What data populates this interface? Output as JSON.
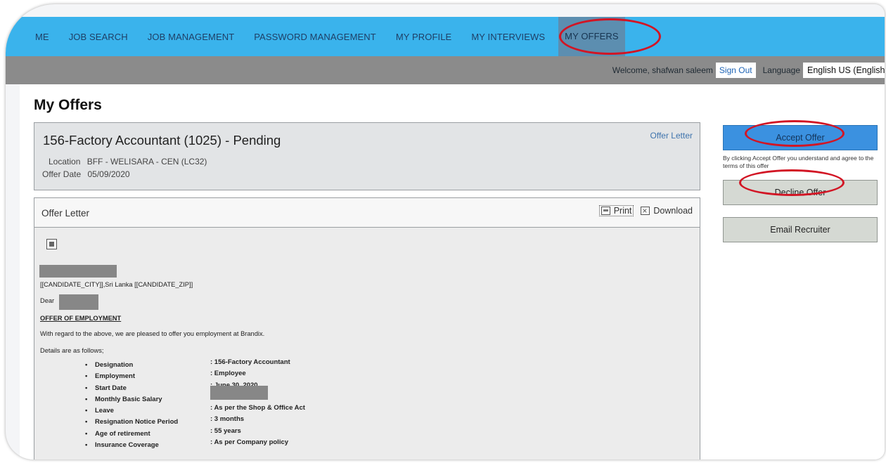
{
  "nav": {
    "items": [
      "ME",
      "JOB SEARCH",
      "JOB MANAGEMENT",
      "PASSWORD MANAGEMENT",
      "MY PROFILE",
      "MY INTERVIEWS",
      "MY OFFERS"
    ],
    "active": "MY OFFERS"
  },
  "header": {
    "welcome": "Welcome, shafwan saleem",
    "sign_out": "Sign Out",
    "language_label": "Language",
    "language_value": "English US (English)"
  },
  "page": {
    "title": "My Offers"
  },
  "offer": {
    "title": "156-Factory Accountant (1025) - Pending",
    "link_label": "Offer Letter",
    "location_label": "Location",
    "location": "BFF - WELISARA - CEN (LC32)",
    "date_label": "Offer Date",
    "date": "05/09/2020"
  },
  "letter": {
    "label": "Offer Letter",
    "print_label": "Print",
    "download_label": "Download",
    "city_line": "[[CANDIDATE_CITY]],Sri Lanka  [[CANDIDATE_ZIP]]",
    "dear": "Dear",
    "heading": "OFFER OF EMPLOYMENT",
    "intro": "With regard to the above, we are pleased to offer you employment at Brandix.",
    "details_intro": "Details are as follows;",
    "details": [
      {
        "key": "Designation",
        "value": ": 156-Factory Accountant"
      },
      {
        "key": "Employment",
        "value": ": Employee"
      },
      {
        "key": "Start Date",
        "value": ": June 30, 2020"
      },
      {
        "key": "Monthly Basic Salary",
        "value": ""
      },
      {
        "key": "Leave",
        "value": ": As per the Shop & Office Act"
      },
      {
        "key": "Resignation Notice Period",
        "value": ": 3 months"
      },
      {
        "key": "Age of retirement",
        "value": ": 55 years"
      },
      {
        "key": "Insurance Coverage",
        "value": ": As per Company policy"
      }
    ]
  },
  "actions": {
    "accept": "Accept Offer",
    "accept_note": "By clicking Accept Offer you understand and agree to the terms of this offer",
    "decline": "Decline Offer",
    "email": "Email Recruiter"
  },
  "colors": {
    "nav_bg": "#3ab3ec",
    "subbar_bg": "#8b8b8b",
    "accept_bg": "#3b91e0",
    "annotation_red": "#d21524"
  }
}
